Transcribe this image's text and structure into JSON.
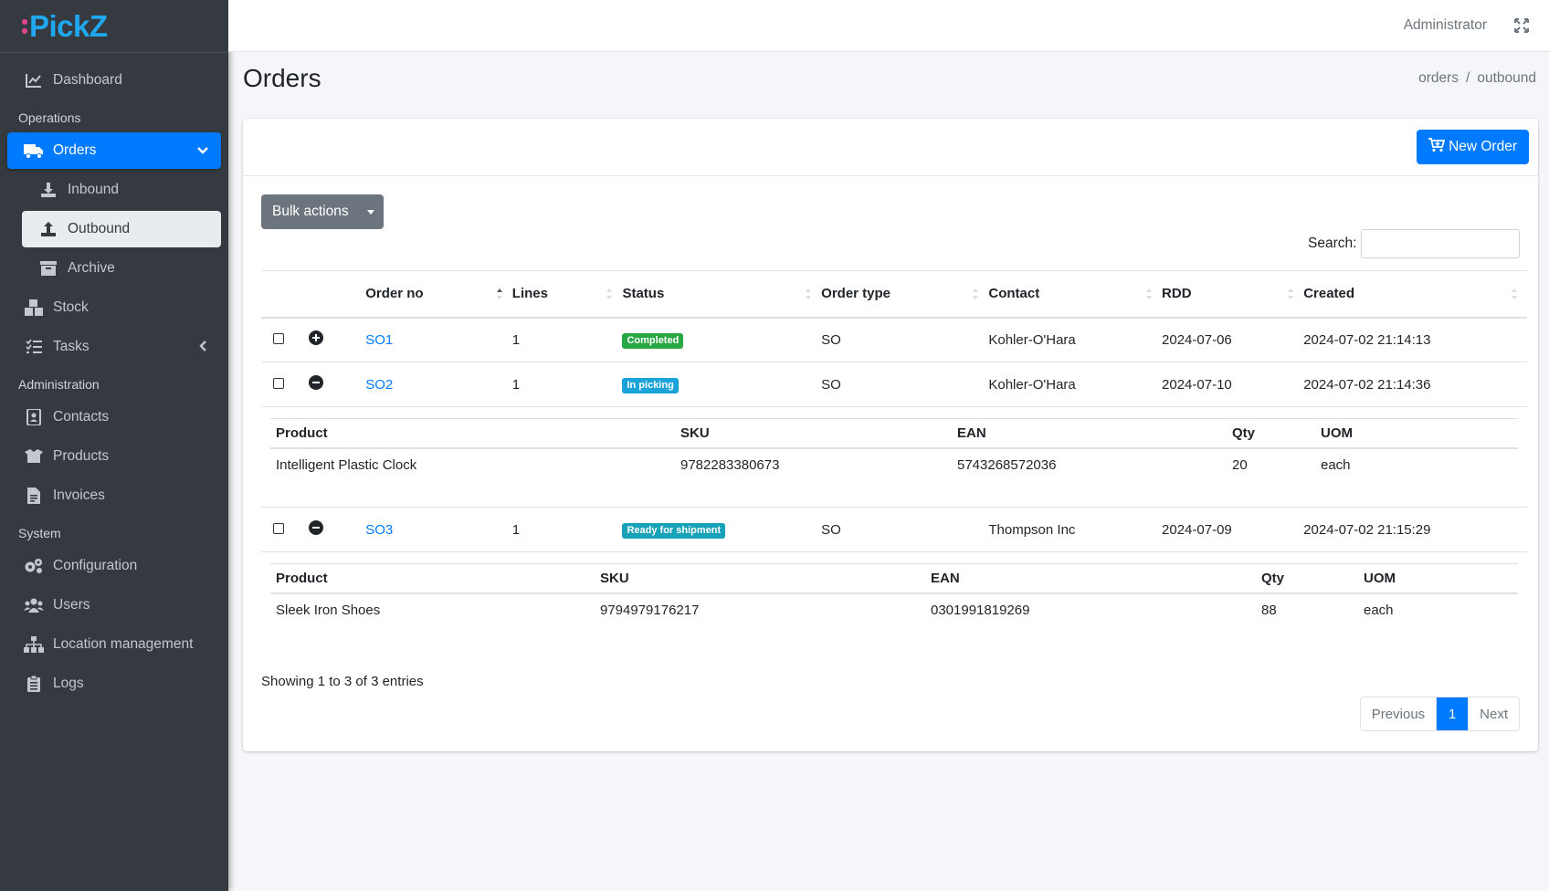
{
  "brand": {
    "name": "PickZ"
  },
  "topbar": {
    "user": "Administrator"
  },
  "sidebar": {
    "items": [
      {
        "label": "Dashboard",
        "icon": "chart-line-icon"
      },
      {
        "header": "Operations"
      },
      {
        "label": "Orders",
        "icon": "truck-icon",
        "active": true
      },
      {
        "label": "Inbound",
        "icon": "download-icon",
        "sub": true
      },
      {
        "label": "Outbound",
        "icon": "upload-icon",
        "sub": true,
        "selected": true
      },
      {
        "label": "Archive",
        "icon": "archive-icon",
        "sub": true
      },
      {
        "label": "Stock",
        "icon": "boxes-icon"
      },
      {
        "label": "Tasks",
        "icon": "tasks-icon"
      },
      {
        "header": "Administration"
      },
      {
        "label": "Contacts",
        "icon": "address-book-icon"
      },
      {
        "label": "Products",
        "icon": "box-open-icon"
      },
      {
        "label": "Invoices",
        "icon": "invoice-icon"
      },
      {
        "header": "System"
      },
      {
        "label": "Configuration",
        "icon": "cogs-icon"
      },
      {
        "label": "Users",
        "icon": "users-icon"
      },
      {
        "label": "Location management",
        "icon": "sitemap-icon"
      },
      {
        "label": "Logs",
        "icon": "clipboard-list-icon"
      }
    ]
  },
  "page": {
    "title": "Orders",
    "breadcrumb": [
      "orders",
      "outbound"
    ]
  },
  "toolbar": {
    "new_order": "New Order",
    "bulk_actions": "Bulk actions",
    "search_label": "Search:",
    "search_value": ""
  },
  "table": {
    "columns": [
      "Order no",
      "Lines",
      "Status",
      "Order type",
      "Contact",
      "RDD",
      "Created"
    ],
    "rows": [
      {
        "order_no": "SO1",
        "lines": "1",
        "status": "Completed",
        "type": "SO",
        "contact": "Kohler-O'Hara",
        "rdd": "2024-07-06",
        "created": "2024-07-02 21:14:13",
        "expanded": false
      },
      {
        "order_no": "SO2",
        "lines": "1",
        "status": "In picking",
        "type": "SO",
        "contact": "Kohler-O'Hara",
        "rdd": "2024-07-10",
        "created": "2024-07-02 21:14:36",
        "expanded": true,
        "detail": {
          "columns": [
            "Product",
            "SKU",
            "EAN",
            "Qty",
            "UOM"
          ],
          "row": [
            "Intelligent Plastic Clock",
            "9782283380673",
            "5743268572036",
            "20",
            "each"
          ]
        }
      },
      {
        "order_no": "SO3",
        "lines": "1",
        "status": "Ready for shipment",
        "type": "SO",
        "contact": "Thompson Inc",
        "rdd": "2024-07-09",
        "created": "2024-07-02 21:15:29",
        "expanded": true,
        "detail": {
          "columns": [
            "Product",
            "SKU",
            "EAN",
            "Qty",
            "UOM"
          ],
          "row": [
            "Sleek Iron Shoes",
            "9794979176217",
            "0301991819269",
            "88",
            "each"
          ]
        }
      }
    ]
  },
  "footer": {
    "info": "Showing 1 to 3 of 3 entries",
    "pagination": {
      "previous": "Previous",
      "current": "1",
      "next": "Next"
    }
  },
  "colors": {
    "primary": "#007bff",
    "sidebar": "#343a40",
    "completed": "#28a745",
    "in_picking": "#1aa3d9",
    "ready": "#17a2b8"
  }
}
